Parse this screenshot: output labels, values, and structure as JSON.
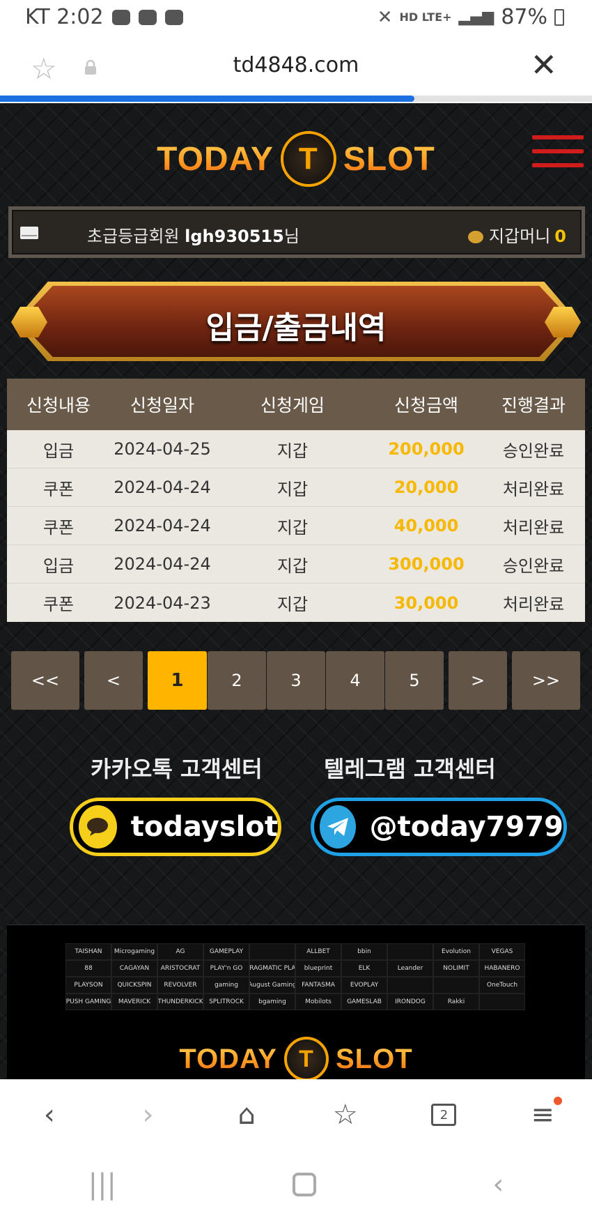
{
  "status_bar": {
    "carrier_time": "KT 2:02",
    "network": "HD LTE+",
    "battery": "87%"
  },
  "browser": {
    "url": "td4848.com",
    "tab_count": "2"
  },
  "logo": {
    "text_left": "TODAY",
    "text_right": "SLOT",
    "emblem": "T"
  },
  "member": {
    "grade": "초급등급회원",
    "username": "lgh930515",
    "suffix": "님",
    "wallet_label": "지갑머니",
    "wallet_amount": "0"
  },
  "page_title": "입금/출금내역",
  "table": {
    "headers": [
      "신청내용",
      "신청일자",
      "신청게임",
      "신청금액",
      "진행결과"
    ],
    "rows": [
      [
        "입금",
        "2024-04-25",
        "지갑",
        "200,000",
        "승인완료"
      ],
      [
        "쿠폰",
        "2024-04-24",
        "지갑",
        "20,000",
        "처리완료"
      ],
      [
        "쿠폰",
        "2024-04-24",
        "지갑",
        "40,000",
        "처리완료"
      ],
      [
        "입금",
        "2024-04-24",
        "지갑",
        "300,000",
        "승인완료"
      ],
      [
        "쿠폰",
        "2024-04-23",
        "지갑",
        "30,000",
        "처리완료"
      ]
    ]
  },
  "pagination": {
    "first": "<<",
    "prev": "<",
    "pages": [
      "1",
      "2",
      "3",
      "4",
      "5"
    ],
    "active": "1",
    "next": ">",
    "last": ">>"
  },
  "support": {
    "kakao_title": "카카오톡 고객센터",
    "kakao_id": "todayslot",
    "telegram_title": "텔레그램 고객센터",
    "telegram_id": "@today7979"
  },
  "providers": [
    "TAISHAN",
    "Microgaming",
    "AG",
    "GAMEPLAY",
    "",
    "ALLBET",
    "bbin",
    "",
    "Evolution",
    "VEGAS",
    "88",
    "CAGAYAN",
    "ARISTOCRAT",
    "PLAY'n GO",
    "PRAGMATIC PLAY",
    "blueprint",
    "ELK",
    "Leander",
    "NOLIMIT",
    "HABANERO",
    "PLAYSON",
    "QUICKSPIN",
    "REVOLVER",
    "gaming",
    "August Gaming",
    "FANTASMA",
    "EVOPLAY",
    "",
    "",
    "OneTouch",
    "PUSH GAMING",
    "MAVERICK",
    "THUNDERKICK",
    "SPLITROCK",
    "bgaming",
    "Mobilots",
    "GAMESLAB",
    "IRONDOG",
    "Rakki",
    ""
  ],
  "colors": {
    "accent_gold": "#f6b800",
    "kakao_yellow": "#f5cf1a",
    "telegram_blue": "#1ea1e6",
    "hamburger_red": "#d11c1c"
  }
}
